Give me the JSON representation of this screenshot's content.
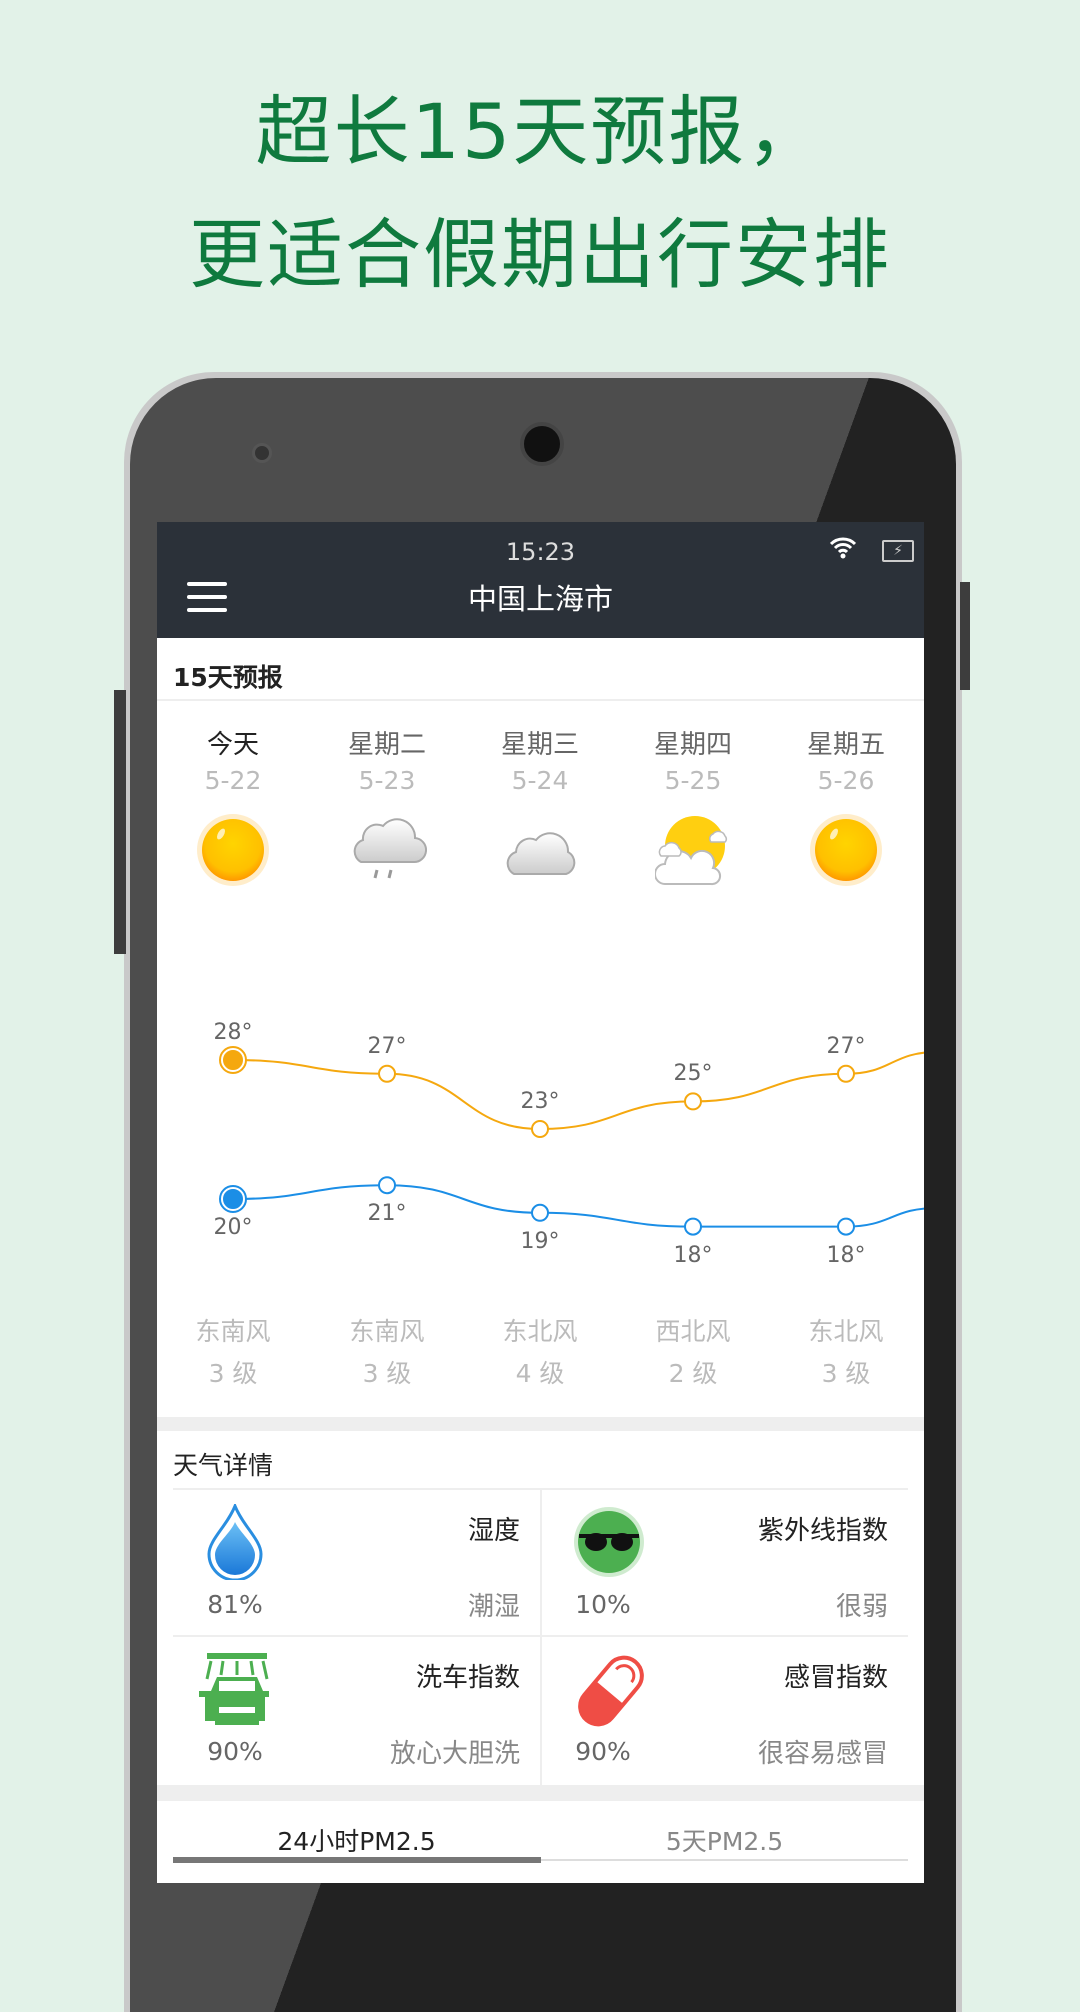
{
  "promo": {
    "line1": "超长15天预报，",
    "line2": "更适合假期出行安排"
  },
  "status_bar": {
    "time": "15:23",
    "wifi_icon": "wifi-icon",
    "battery_icon": "battery-charging-icon"
  },
  "app_bar": {
    "title": "中国上海市",
    "menu_icon": "hamburger-menu-icon"
  },
  "forecast": {
    "section_title": "15天预报",
    "days": [
      {
        "name": "今天",
        "date": "5-22",
        "icon": "sunny",
        "high": "28°",
        "low": "20°",
        "wind": "东南风",
        "level": "3 级"
      },
      {
        "name": "星期二",
        "date": "5-23",
        "icon": "rain",
        "high": "27°",
        "low": "21°",
        "wind": "东南风",
        "level": "3 级"
      },
      {
        "name": "星期三",
        "date": "5-24",
        "icon": "cloudy",
        "high": "23°",
        "low": "19°",
        "wind": "东北风",
        "level": "4 级"
      },
      {
        "name": "星期四",
        "date": "5-25",
        "icon": "partly-cloudy",
        "high": "25°",
        "low": "18°",
        "wind": "西北风",
        "level": "2 级"
      },
      {
        "name": "星期五",
        "date": "5-26",
        "icon": "sunny",
        "high": "27°",
        "low": "18°",
        "wind": "东北风",
        "level": "3 级"
      }
    ],
    "colors": {
      "high": "#f5a80f",
      "low": "#1b8ee6"
    }
  },
  "details": {
    "section_title": "天气详情",
    "items": [
      {
        "name": "湿度",
        "value": "81%",
        "desc": "潮湿",
        "icon": "water-drop-icon"
      },
      {
        "name": "紫外线指数",
        "value": "10%",
        "desc": "很弱",
        "icon": "sunglasses-icon"
      },
      {
        "name": "洗车指数",
        "value": "90%",
        "desc": "放心大胆洗",
        "icon": "car-wash-icon"
      },
      {
        "name": "感冒指数",
        "value": "90%",
        "desc": "很容易感冒",
        "icon": "pill-icon"
      }
    ]
  },
  "pm_tabs": [
    {
      "label": "24小时PM2.5",
      "active": true
    },
    {
      "label": "5天PM2.5",
      "active": false
    }
  ]
}
